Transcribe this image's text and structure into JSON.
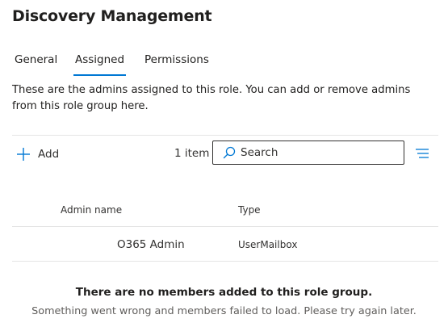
{
  "header": {
    "title": "Discovery Management"
  },
  "tabs": [
    {
      "label": "General",
      "active": false
    },
    {
      "label": "Assigned",
      "active": true
    },
    {
      "label": "Permissions",
      "active": false
    }
  ],
  "description": "These are the admins assigned to this role. You can add or remove admins from this role group here.",
  "toolbar": {
    "add_label": "Add",
    "add_icon": "plus-icon",
    "item_count": "1 item",
    "search_placeholder": "Search",
    "search_icon": "search-icon",
    "filter_icon": "filter-lines-icon"
  },
  "table": {
    "columns": [
      "Admin name",
      "Type"
    ],
    "rows": [
      {
        "admin_name": "O365 Admin",
        "type": "UserMailbox"
      }
    ]
  },
  "empty_state": {
    "title": "There are no members added to this role group.",
    "message": "Something went wrong and members failed to load. Please try again later."
  },
  "colors": {
    "accent": "#0078d4",
    "text": "#201f1e",
    "secondary_text": "#605e5c",
    "divider": "#e5e5e5"
  }
}
